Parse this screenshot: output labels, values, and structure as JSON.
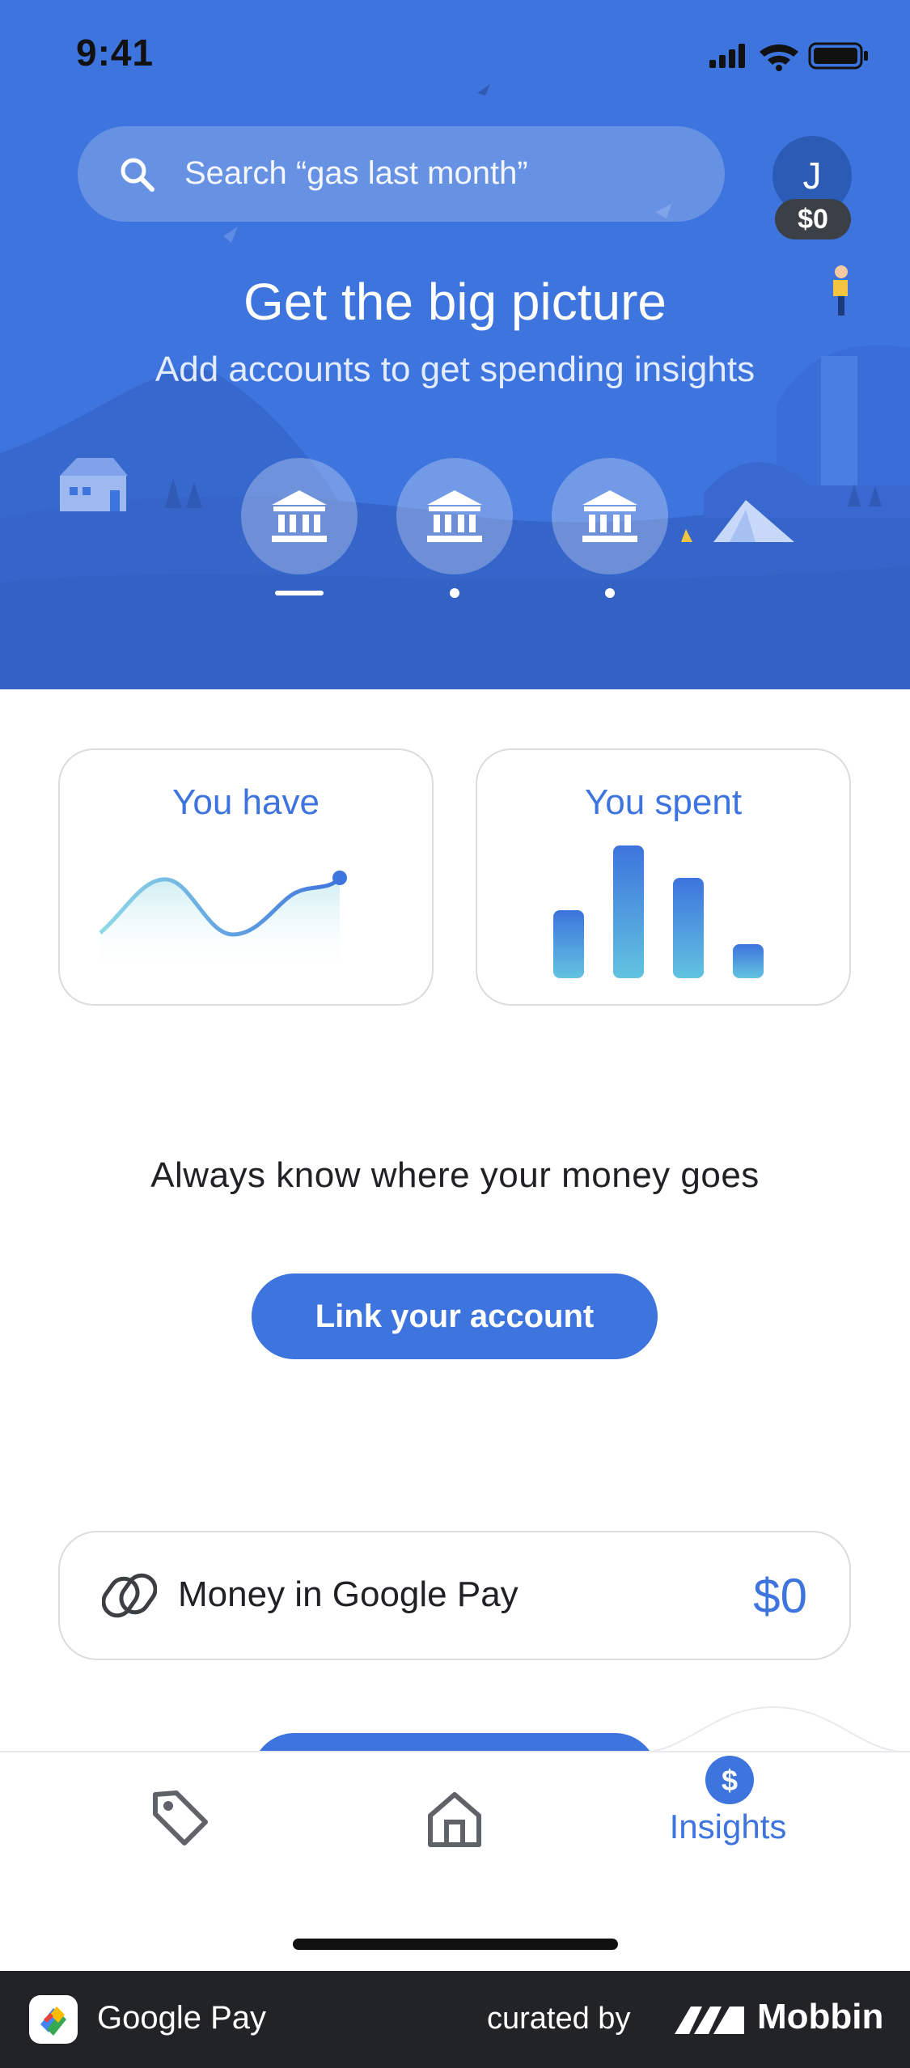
{
  "status_bar": {
    "time": "9:41"
  },
  "search": {
    "placeholder": "Search “gas last month”"
  },
  "profile": {
    "initial": "J",
    "balance": "$0"
  },
  "hero": {
    "title": "Get the big picture",
    "subtitle": "Add accounts to get spending insights",
    "carousel": {
      "items": 3,
      "active_index": 0
    }
  },
  "cards": {
    "have": {
      "title": "You have"
    },
    "spent": {
      "title": "You spent"
    }
  },
  "tagline": "Always know where your money goes",
  "link_button": {
    "label": "Link your account"
  },
  "money_row": {
    "label": "Money in Google Pay",
    "value": "$0"
  },
  "nav": {
    "items": [
      {
        "icon": "tag-icon"
      },
      {
        "icon": "home-icon"
      },
      {
        "icon": "dollar-icon",
        "label": "Insights",
        "active": true
      }
    ]
  },
  "footer": {
    "app_name": "Google Pay",
    "curated_by": "curated by",
    "brand": "Mobbin"
  },
  "colors": {
    "accent": "#3d74dd",
    "hero_bg": "#3d74dd",
    "footer_bg": "#222326"
  }
}
